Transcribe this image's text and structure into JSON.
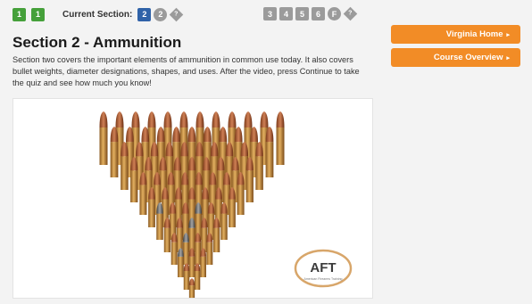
{
  "nav": {
    "progress_steps": [
      "1",
      "1"
    ],
    "current_section_label": "Current Section:",
    "current_steps": [
      "2"
    ],
    "current_circle_steps": [
      "2"
    ],
    "current_diamond": "?",
    "later_steps": [
      "3",
      "4",
      "5",
      "6"
    ],
    "later_circle": "F",
    "later_diamond": "?"
  },
  "section": {
    "title": "Section 2 - Ammunition",
    "description": "Section two covers the important elements of ammunition in common use today. It also covers bullet weights, diameter designations, shapes, and uses.  After the video, press Continue to take the quiz and see how much you know!"
  },
  "video": {
    "logo_text": "AFT",
    "logo_subtext": "American Firearms Training"
  },
  "sidebar": {
    "virginia_home": "Virginia Home",
    "course_overview": "Course Overview",
    "arrow": "▸"
  },
  "colors": {
    "accent": "#f28c26",
    "done_step": "#45a03a",
    "current_step": "#2f62a8",
    "locked_step": "#9b9b9b"
  }
}
